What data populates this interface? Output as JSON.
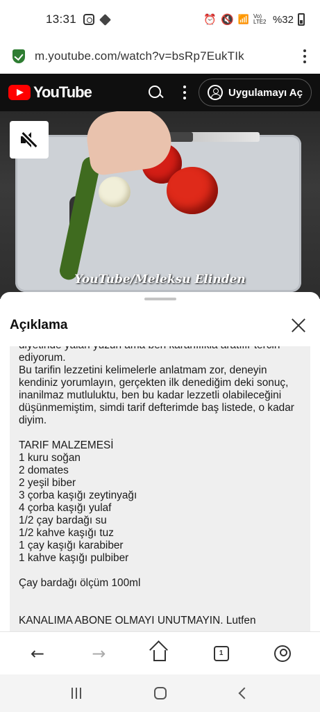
{
  "status_bar": {
    "time": "13:31",
    "battery": "%32",
    "signal_label": "Vo) LTE2"
  },
  "browser": {
    "url": "m.youtube.com/watch?v=bsRp7EukTIk"
  },
  "youtube_header": {
    "logo_text": "YouTube",
    "open_app_label": "Uygulamayı Aç"
  },
  "video": {
    "watermark": "YouTube/Meleksu Elinden"
  },
  "description": {
    "title": "Açıklama",
    "text": "diyetinde yalan yüzün ama ben kararlılıkla aratılır tercih ediyorum.\nBu tarifin lezzetini kelimelerle anlatmam zor, deneyin kendiniz yorumlayın, gerçekten ilk denediğim deki sonuç, inanilmaz mutluluktu, ben bu kadar lezzetli olabileceğini düşünmemiştim, simdi tarif defterimde baş listede, o kadar diyim.\n\nTARIF MALZEMESİ\n1 kuru soğan\n2 domates\n2 yeşil biber\n3 çorba kaşığı zeytinyağı\n4 çorba kaşığı yulaf\n1/2 çay bardağı su\n1/2 kahve kaşığı tuz\n1 çay kaşığı karabiber\n1 kahve kaşığı pulbiber\n\nÇay bardağı ölçüm 100ml\n\n\nKANALIMA ABONE OLMAYI UNUTMAYIN. Lutfen"
  },
  "browser_nav": {
    "tab_count": "1",
    "back_glyph": "←",
    "forward_glyph": "→"
  },
  "colors": {
    "youtube_red": "#ff0000",
    "header_bg": "#0f0f0f",
    "secure_green": "#2e7d32"
  }
}
